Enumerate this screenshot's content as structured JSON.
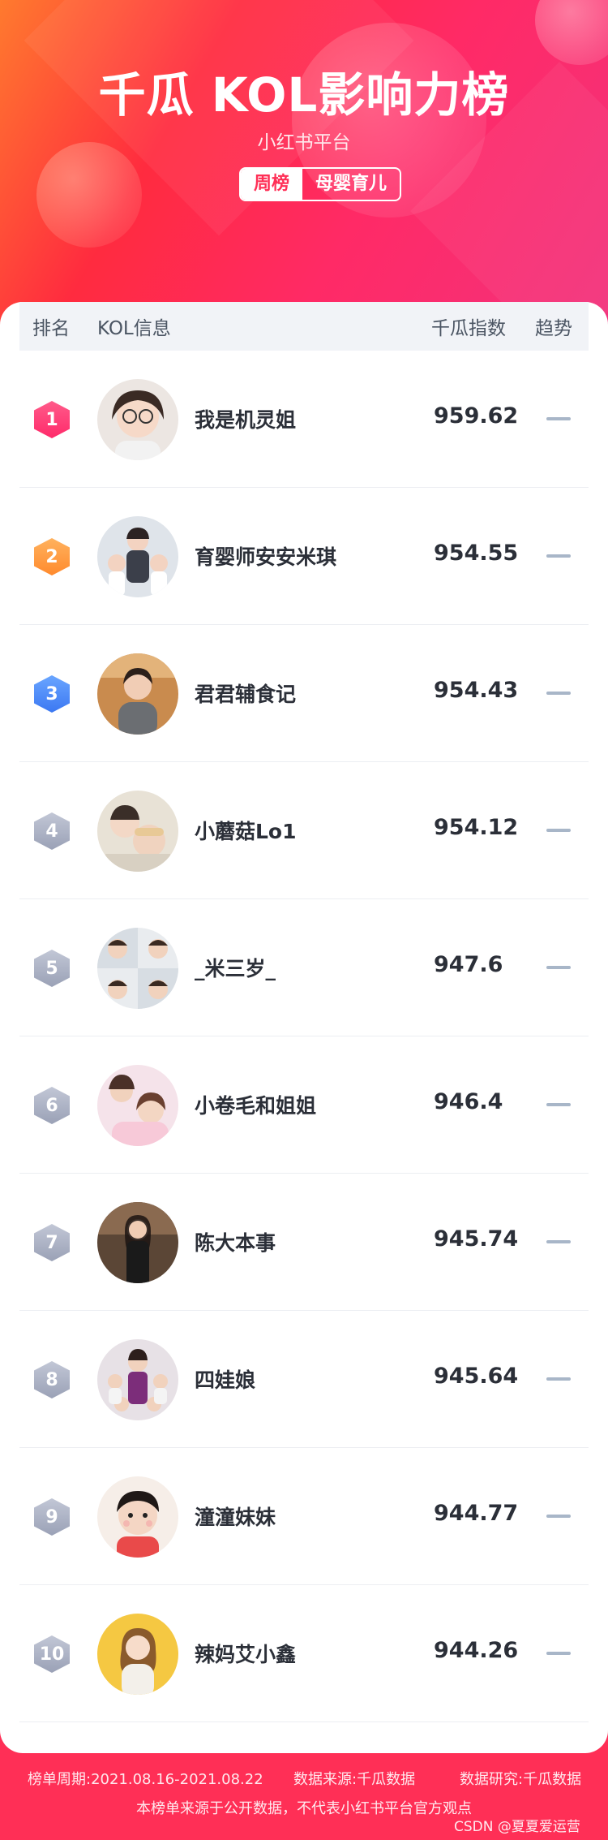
{
  "header": {
    "title": "千瓜 KOL影响力榜",
    "subtitle": "小红书平台",
    "tag_period": "周榜",
    "tag_category": "母婴育儿"
  },
  "table": {
    "columns": [
      "排名",
      "KOL信息",
      "千瓜指数",
      "趋势"
    ],
    "rows": [
      {
        "rank": "1",
        "name": "我是机灵姐",
        "score": "959.62"
      },
      {
        "rank": "2",
        "name": "育婴师安安米琪",
        "score": "954.55"
      },
      {
        "rank": "3",
        "name": "君君辅食记",
        "score": "954.43"
      },
      {
        "rank": "4",
        "name": "小蘑菇Lo1",
        "score": "954.12"
      },
      {
        "rank": "5",
        "name": "_米三岁_",
        "score": "947.6"
      },
      {
        "rank": "6",
        "name": "小卷毛和姐姐",
        "score": "946.4"
      },
      {
        "rank": "7",
        "name": "陈大本事",
        "score": "945.74"
      },
      {
        "rank": "8",
        "name": "四娃娘",
        "score": "945.64"
      },
      {
        "rank": "9",
        "name": "潼潼妹妹",
        "score": "944.77"
      },
      {
        "rank": "10",
        "name": "辣妈艾小鑫",
        "score": "944.26"
      }
    ]
  },
  "footer": {
    "period": "榜单周期:2021.08.16-2021.08.22",
    "source": "数据来源:千瓜数据",
    "research": "数据研究:千瓜数据",
    "disclaimer": "本榜单来源于公开数据，不代表小红书平台官方观点",
    "watermark": "CSDN @夏夏爱运营"
  },
  "colors": {
    "brand": "#ff2f56",
    "rank1": "#ff2a6a",
    "rank2": "#ff8a2d",
    "rank3": "#3b78f2",
    "rank_other": "#9aa1b6",
    "trend_flat": "#a8b6c8"
  },
  "icons": {
    "trend": "trend-flat-icon",
    "rank": "rank-hexagon-icon"
  }
}
